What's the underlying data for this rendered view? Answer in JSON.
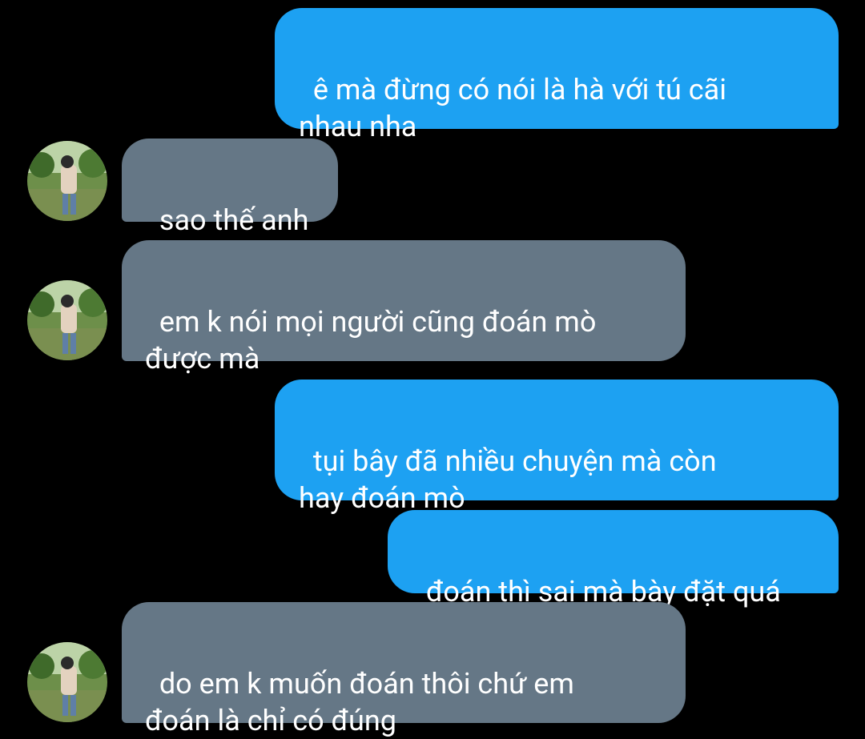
{
  "conversation": {
    "messages": [
      {
        "direction": "outgoing",
        "text": "ê mà đừng có nói là hà với tú cãi\nnhau nha"
      },
      {
        "direction": "incoming",
        "text": "sao thế anh",
        "avatar": "user-avatar-photo"
      },
      {
        "direction": "incoming",
        "text": "em k nói mọi người cũng đoán mò\nđược mà",
        "avatar": "user-avatar-photo"
      },
      {
        "direction": "outgoing",
        "text": "tụi bây đã nhiều chuyện mà còn\nhay đoán mò"
      },
      {
        "direction": "outgoing",
        "text": "đoán thì sai mà bày đặt quá"
      },
      {
        "direction": "incoming",
        "text": "do em k muốn đoán thôi chứ em\nđoán là chỉ có đúng",
        "avatar": "user-avatar-photo"
      }
    ]
  },
  "colors": {
    "background": "#000000",
    "outgoing_bubble": "#1da1f2",
    "incoming_bubble": "#657786",
    "text": "#ffffff"
  }
}
